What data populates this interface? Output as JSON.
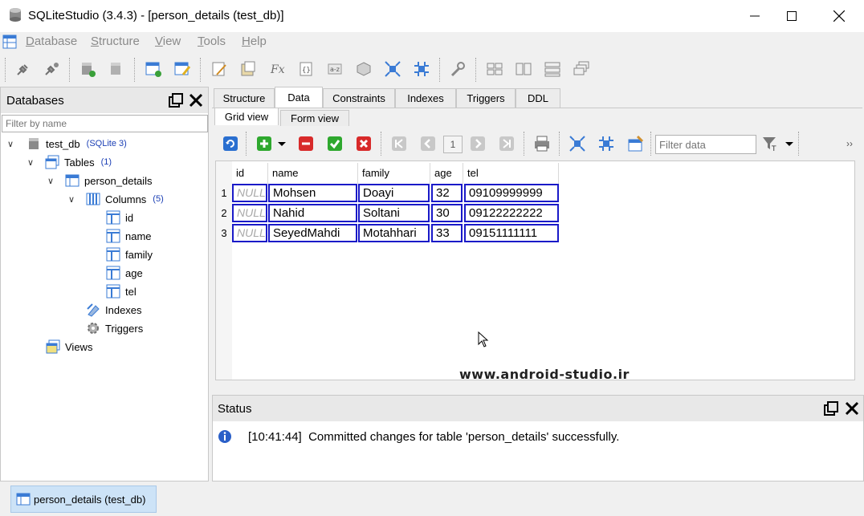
{
  "window": {
    "title": "SQLiteStudio (3.4.3) - [person_details (test_db)]",
    "minimize_icon": "minimize-icon",
    "maximize_icon": "maximize-icon",
    "close_icon": "close-icon"
  },
  "menu": {
    "items": [
      "Database",
      "Structure",
      "View",
      "Tools",
      "Help"
    ],
    "underline": [
      "D",
      "S",
      "V",
      "T",
      "H"
    ]
  },
  "databases_panel": {
    "title": "Databases",
    "filter_placeholder": "Filter by name",
    "tree": {
      "db_name": "test_db",
      "db_badge": "(SQLite 3)",
      "tables_label": "Tables",
      "tables_badge": "(1)",
      "table_name": "person_details",
      "columns_label": "Columns",
      "columns_badge": "(5)",
      "columns": [
        "id",
        "name",
        "family",
        "age",
        "tel"
      ],
      "indexes_label": "Indexes",
      "triggers_label": "Triggers",
      "views_label": "Views"
    }
  },
  "editor": {
    "tabs": [
      "Structure",
      "Data",
      "Constraints",
      "Indexes",
      "Triggers",
      "DDL"
    ],
    "active_tab": "Data",
    "subtabs": [
      "Grid view",
      "Form view"
    ],
    "active_subtab": "Grid view",
    "page_number": "1",
    "filter_placeholder": "Filter data",
    "more_glyph": "››"
  },
  "grid": {
    "columns": [
      "id",
      "name",
      "family",
      "age",
      "tel"
    ],
    "rows": [
      {
        "num": "1",
        "id": "NULL",
        "name": "Mohsen",
        "family": "Doayi",
        "age": "32",
        "tel": "09109999999"
      },
      {
        "num": "2",
        "id": "NULL",
        "name": "Nahid",
        "family": "Soltani",
        "age": "30",
        "tel": "09122222222"
      },
      {
        "num": "3",
        "id": "NULL",
        "name": "SeyedMahdi",
        "family": "Motahhari",
        "age": "33",
        "tel": "09151111111"
      }
    ],
    "watermark": "www.android-studio.ir"
  },
  "status_panel": {
    "title": "Status",
    "message_time": "[10:41:44]",
    "message_text": "Committed changes for table 'person_details' successfully."
  },
  "bottom_bar": {
    "window_tab": "person_details (test_db)"
  },
  "colors": {
    "accent_blue": "#1a1ac8",
    "badge_blue": "#1b3fb5",
    "selected_tab": "#cde3f7"
  }
}
